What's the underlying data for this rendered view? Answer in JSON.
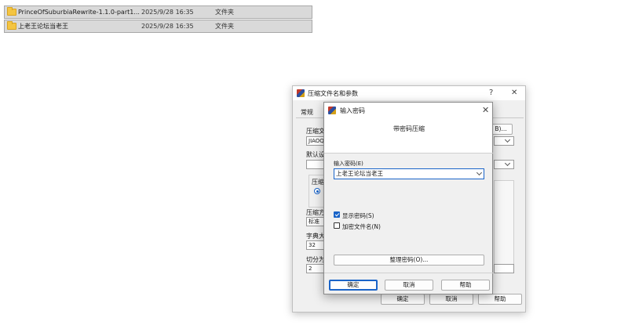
{
  "files": [
    {
      "name": "PrinceOfSuburbiaRewrite-1.1.0-part1...",
      "date": "2025/9/28 16:35",
      "type": "文件夹"
    },
    {
      "name": "上老王论坛当老王",
      "date": "2025/9/28 16:35",
      "type": "文件夹"
    }
  ],
  "back_dialog": {
    "title": "压缩文件名和参数",
    "help_glyph": "?",
    "close_glyph": "✕",
    "tab_general": "常规",
    "archive_name_label": "压缩文",
    "archive_name_value": "JIAOQ",
    "browse_label": "B)...",
    "default_settings_label": "默认设",
    "archive_format_label": "压缩",
    "method_label": "压缩方",
    "method_value": "标准",
    "dict_label": "字典大",
    "dict_value": "32",
    "split_label": "切分为",
    "split_value": "2",
    "ok_label": "确定",
    "cancel_label": "取消",
    "help_label": "帮助"
  },
  "pwd_dialog": {
    "title": "输入密码",
    "close_glyph": "✕",
    "header": "带密码压缩",
    "password_label": "输入密码(E)",
    "password_value": "上老王论坛当老王",
    "show_password_label": "显示密码(S)",
    "show_password_checked": true,
    "encrypt_names_label": "加密文件名(N)",
    "encrypt_names_checked": false,
    "organize_label": "整理密码(O)...",
    "ok_label": "确定",
    "cancel_label": "取消",
    "help_label": "帮助"
  }
}
